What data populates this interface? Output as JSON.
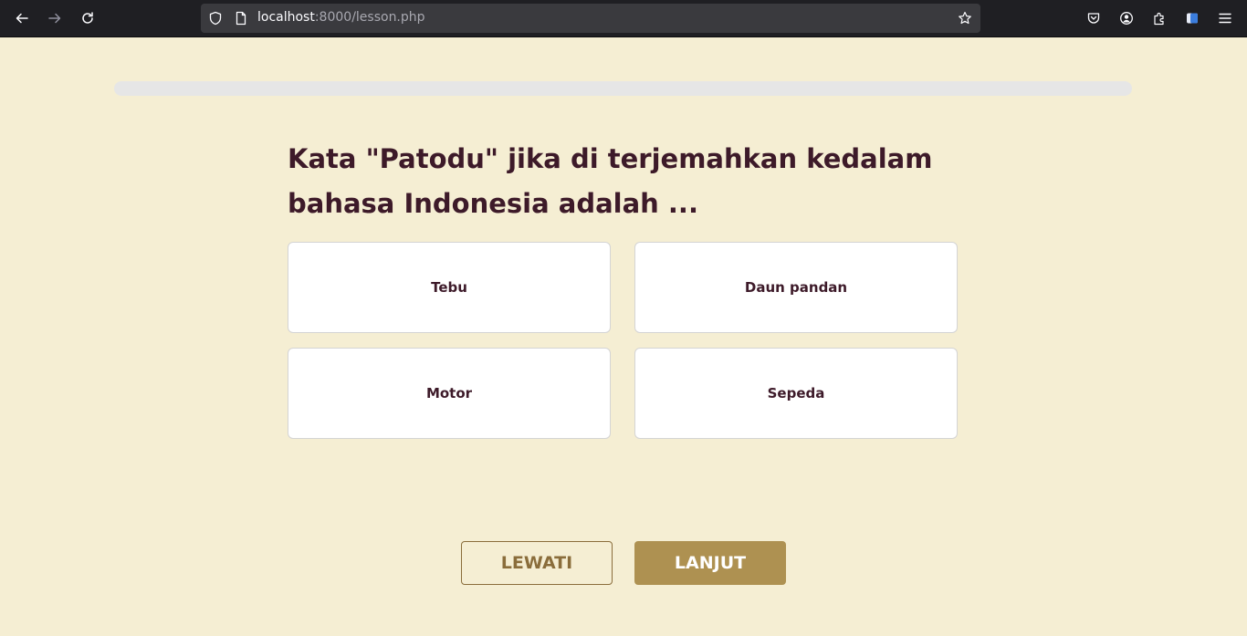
{
  "browser": {
    "url_host": "localhost",
    "url_rest": ":8000/lesson.php"
  },
  "lesson": {
    "progress": 0,
    "question": "Kata \"Patodu\" jika di terjemahkan kedalam bahasa Indonesia adalah ...",
    "options": [
      "Tebu",
      "Daun pandan",
      "Motor",
      "Sepeda"
    ],
    "skip_label": "LEWATI",
    "next_label": "LANJUT"
  },
  "colors": {
    "background": "#f5eed3",
    "accent": "#ae9151",
    "text": "#3d1a29"
  }
}
